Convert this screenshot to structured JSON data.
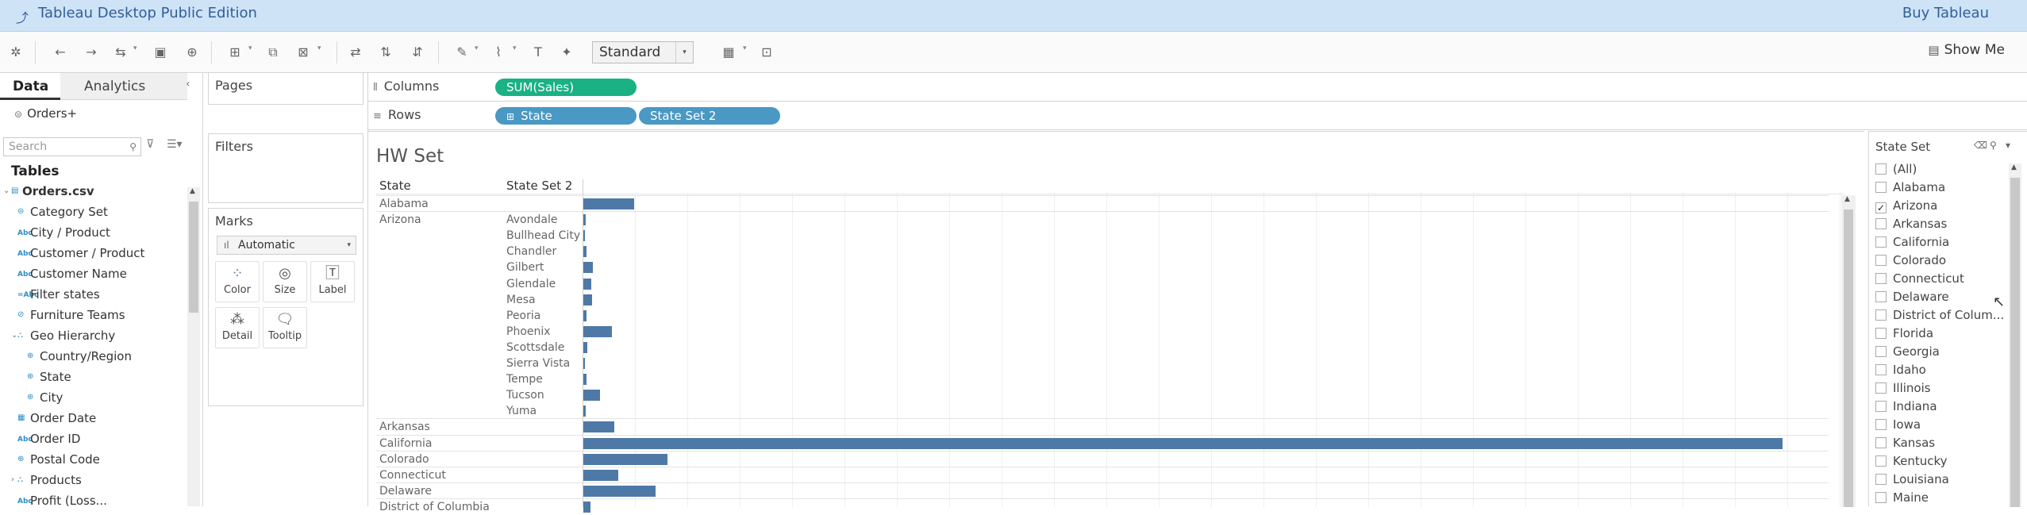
{
  "titlebar": {
    "app_title": "Tableau Desktop Public Edition",
    "buy_label": "Buy Tableau"
  },
  "toolbar": {
    "fit_value": "Standard",
    "show_me_label": "Show Me"
  },
  "data_pane": {
    "tab_data": "Data",
    "tab_analytics": "Analytics",
    "data_source": "Orders+",
    "search_placeholder": "Search",
    "tables_heading": "Tables",
    "tree": [
      {
        "label": "Orders.csv",
        "icon": "table-icon",
        "level": 0,
        "bold": true,
        "expanded": true
      },
      {
        "label": "Category Set",
        "icon": "set-icon",
        "level": 1
      },
      {
        "label": "City / Product",
        "icon": "abc-icon",
        "level": 1
      },
      {
        "label": "Customer / Product",
        "icon": "abc-icon",
        "level": 1
      },
      {
        "label": "Customer Name",
        "icon": "abc-icon",
        "level": 1
      },
      {
        "label": "Filter states",
        "icon": "calc-icon",
        "level": 1
      },
      {
        "label": "Furniture Teams",
        "icon": "group-icon",
        "level": 1
      },
      {
        "label": "Geo Hierarchy",
        "icon": "hierarchy-icon",
        "level": 1,
        "expanded": true
      },
      {
        "label": "Country/Region",
        "icon": "globe-icon",
        "level": 2
      },
      {
        "label": "State",
        "icon": "globe-icon",
        "level": 2
      },
      {
        "label": "City",
        "icon": "globe-icon",
        "level": 2
      },
      {
        "label": "Order Date",
        "icon": "date-icon",
        "level": 1
      },
      {
        "label": "Order ID",
        "icon": "abc-icon",
        "level": 1
      },
      {
        "label": "Postal Code",
        "icon": "globe-icon",
        "level": 1
      },
      {
        "label": "Products",
        "icon": "hierarchy-icon",
        "level": 1,
        "collapsed": true
      },
      {
        "label": "Profit (Loss...",
        "icon": "abc-icon",
        "level": 1
      }
    ]
  },
  "cards": {
    "pages": "Pages",
    "filters": "Filters",
    "marks": "Marks",
    "marks_type": "Automatic",
    "mark_buttons": [
      "Color",
      "Size",
      "Label",
      "Detail",
      "Tooltip"
    ]
  },
  "shelves": {
    "columns_label": "Columns",
    "rows_label": "Rows",
    "columns_pill": "SUM(Sales)",
    "rows_pills": [
      "State",
      "State Set 2"
    ]
  },
  "view": {
    "title": "HW Set",
    "header_state": "State",
    "header_set": "State Set 2"
  },
  "chart_data": {
    "type": "bar",
    "orientation": "horizontal",
    "measure": "SUM(Sales)",
    "rows": [
      {
        "state": "Alabama",
        "city": "",
        "value": 19511
      },
      {
        "state": "Arizona",
        "city": "Avondale",
        "value": 947
      },
      {
        "state": "",
        "city": "Bullhead City",
        "value": 22
      },
      {
        "state": "",
        "city": "Chandler",
        "value": 1069
      },
      {
        "state": "",
        "city": "Gilbert",
        "value": 3573
      },
      {
        "state": "",
        "city": "Glendale",
        "value": 2918
      },
      {
        "state": "",
        "city": "Mesa",
        "value": 3388
      },
      {
        "state": "",
        "city": "Peoria",
        "value": 1108
      },
      {
        "state": "",
        "city": "Phoenix",
        "value": 11000
      },
      {
        "state": "",
        "city": "Scottsdale",
        "value": 1467
      },
      {
        "state": "",
        "city": "Sierra Vista",
        "value": 76
      },
      {
        "state": "",
        "city": "Tempe",
        "value": 1070
      },
      {
        "state": "",
        "city": "Tucson",
        "value": 6313
      },
      {
        "state": "",
        "city": "Yuma",
        "value": 840
      },
      {
        "state": "Arkansas",
        "city": "",
        "value": 11678
      },
      {
        "state": "California",
        "city": "",
        "value": 457688
      },
      {
        "state": "Colorado",
        "city": "",
        "value": 32108
      },
      {
        "state": "Connecticut",
        "city": "",
        "value": 13384
      },
      {
        "state": "Delaware",
        "city": "",
        "value": 27451
      },
      {
        "state": "District of Columbia",
        "city": "",
        "value": 2865
      }
    ],
    "xlim": [
      0,
      480000
    ],
    "grid": true
  },
  "filter_card": {
    "title": "State Set",
    "items": [
      {
        "label": "(All)",
        "checked": false
      },
      {
        "label": "Alabama",
        "checked": false
      },
      {
        "label": "Arizona",
        "checked": true
      },
      {
        "label": "Arkansas",
        "checked": false
      },
      {
        "label": "California",
        "checked": false
      },
      {
        "label": "Colorado",
        "checked": false
      },
      {
        "label": "Connecticut",
        "checked": false
      },
      {
        "label": "Delaware",
        "checked": false
      },
      {
        "label": "District of Colum...",
        "checked": false
      },
      {
        "label": "Florida",
        "checked": false
      },
      {
        "label": "Georgia",
        "checked": false
      },
      {
        "label": "Idaho",
        "checked": false
      },
      {
        "label": "Illinois",
        "checked": false
      },
      {
        "label": "Indiana",
        "checked": false
      },
      {
        "label": "Iowa",
        "checked": false
      },
      {
        "label": "Kansas",
        "checked": false
      },
      {
        "label": "Kentucky",
        "checked": false
      },
      {
        "label": "Louisiana",
        "checked": false
      },
      {
        "label": "Maine",
        "checked": false
      }
    ]
  },
  "colors": {
    "accent": "#4e79a7",
    "measure_pill": "#1ab184",
    "dimension_pill": "#4a98c4",
    "titlebar": "#cfe3f6"
  }
}
